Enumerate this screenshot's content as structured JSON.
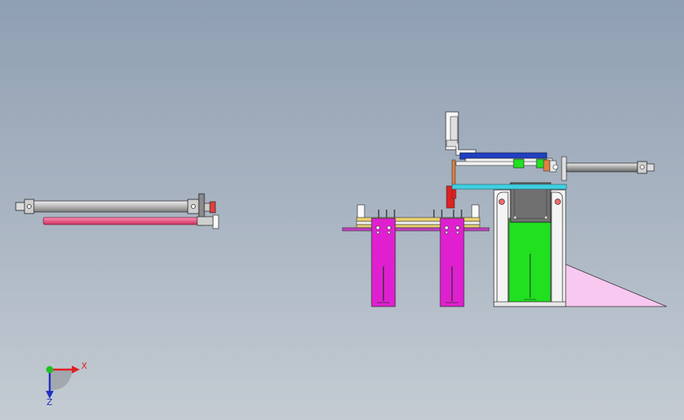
{
  "triad": {
    "x_label": "X",
    "z_label": "Z",
    "x_color": "#e02020",
    "z_color": "#2030c0",
    "y_color": "#20c020"
  },
  "colors": {
    "cylinder": "#c8c8c8",
    "rod_pink": "#e0507a",
    "magenta": "#e020d0",
    "green": "#20e020",
    "blue_bar": "#2040c0",
    "cyan": "#40d0e0",
    "red_block": "#e02020",
    "pink_wedge": "#f8c8f0",
    "frame_white": "#f4f4f4",
    "plate_gray": "#707070",
    "yellow": "#e8d070",
    "orange": "#e08040",
    "purple": "#c040c0"
  }
}
